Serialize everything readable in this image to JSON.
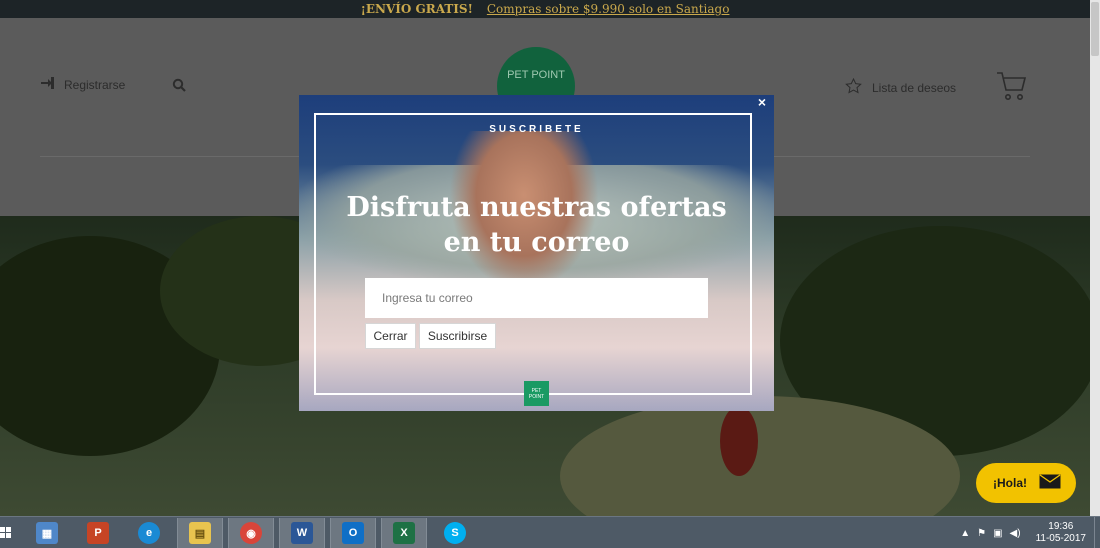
{
  "promo": {
    "headline": "¡ENVÍO GRATIS!",
    "link_text": "Compras sobre $9.990 solo en Santiago"
  },
  "header": {
    "register_label": "Registrarse",
    "wishlist_label": "Lista de deseos",
    "logo_text": "PET POINT"
  },
  "modal": {
    "kicker": "SUSCRIBETE",
    "title_line1": "Disfruta nuestras ofertas",
    "title_line2": "en tu correo",
    "email_placeholder": "Ingresa tu correo",
    "close_button": "Cerrar",
    "subscribe_button": "Suscribirse",
    "close_icon": "×",
    "mini_logo_text": "PET POINT"
  },
  "chat": {
    "label": "¡Hola!"
  },
  "taskbar": {
    "apps": [
      {
        "name": "calculator",
        "glyph": "▦",
        "color": "#4f87c9"
      },
      {
        "name": "powerpoint",
        "glyph": "P",
        "color": "#c64425"
      },
      {
        "name": "internet-explorer",
        "glyph": "e",
        "color": "#1a8ad4"
      },
      {
        "name": "file-explorer",
        "glyph": "▤",
        "color": "#e8c44f"
      },
      {
        "name": "chrome",
        "glyph": "◉",
        "color": "#d9453a"
      },
      {
        "name": "word",
        "glyph": "W",
        "color": "#2b5797"
      },
      {
        "name": "outlook",
        "glyph": "O",
        "color": "#0f6fc6"
      },
      {
        "name": "excel",
        "glyph": "X",
        "color": "#1e7145"
      },
      {
        "name": "skype",
        "glyph": "S",
        "color": "#00aff0"
      }
    ],
    "time": "19:36",
    "date": "11-05-2017"
  },
  "colors": {
    "promo_text": "#c9a84c",
    "logo_green": "#11623d",
    "chat_yellow": "#f2c200",
    "taskbar": "#4e5a66"
  }
}
